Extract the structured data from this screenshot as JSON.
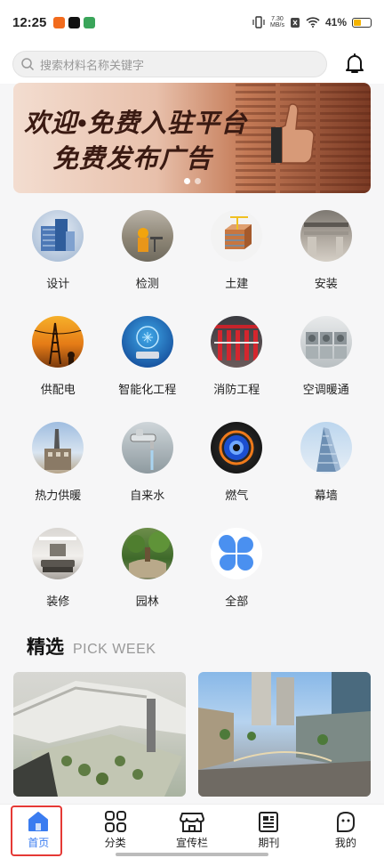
{
  "status_bar": {
    "time": "12:25",
    "speed_value": "7.30",
    "speed_unit": "MB/s",
    "battery": "41%"
  },
  "search": {
    "placeholder": "搜索材料名称关键字"
  },
  "banner": {
    "line1": "欢迎•免费入驻平台",
    "line2": "免费发布广告",
    "active_slide": 0,
    "slides": 2
  },
  "categories": [
    {
      "label": "设计",
      "icon": "design-photo"
    },
    {
      "label": "检测",
      "icon": "inspection-photo"
    },
    {
      "label": "土建",
      "icon": "civil-construction-photo"
    },
    {
      "label": "安装",
      "icon": "installation-photo"
    },
    {
      "label": "供配电",
      "icon": "power-supply-photo"
    },
    {
      "label": "智能化工程",
      "icon": "intelligent-engineering-photo"
    },
    {
      "label": "消防工程",
      "icon": "fire-engineering-photo"
    },
    {
      "label": "空调暖通",
      "icon": "hvac-photo"
    },
    {
      "label": "热力供暖",
      "icon": "heating-photo"
    },
    {
      "label": "自来水",
      "icon": "tap-water-photo"
    },
    {
      "label": "燃气",
      "icon": "gas-flame-photo"
    },
    {
      "label": "幕墙",
      "icon": "curtain-wall-photo"
    },
    {
      "label": "装修",
      "icon": "decoration-photo"
    },
    {
      "label": "园林",
      "icon": "garden-photo"
    },
    {
      "label": "全部",
      "icon": "all-grid-icon"
    }
  ],
  "section": {
    "title": "精选",
    "subtitle": "PICK WEEK"
  },
  "tabs": [
    {
      "label": "首页",
      "icon": "home-icon",
      "active": true
    },
    {
      "label": "分类",
      "icon": "category-grid-icon",
      "active": false
    },
    {
      "label": "宣传栏",
      "icon": "storefront-icon",
      "active": false
    },
    {
      "label": "期刊",
      "icon": "newspaper-icon",
      "active": false
    },
    {
      "label": "我的",
      "icon": "profile-face-icon",
      "active": false
    }
  ],
  "colors": {
    "accent": "#3a7cf0",
    "highlight_border": "#e53935",
    "all_icon": "#4a90f0"
  }
}
